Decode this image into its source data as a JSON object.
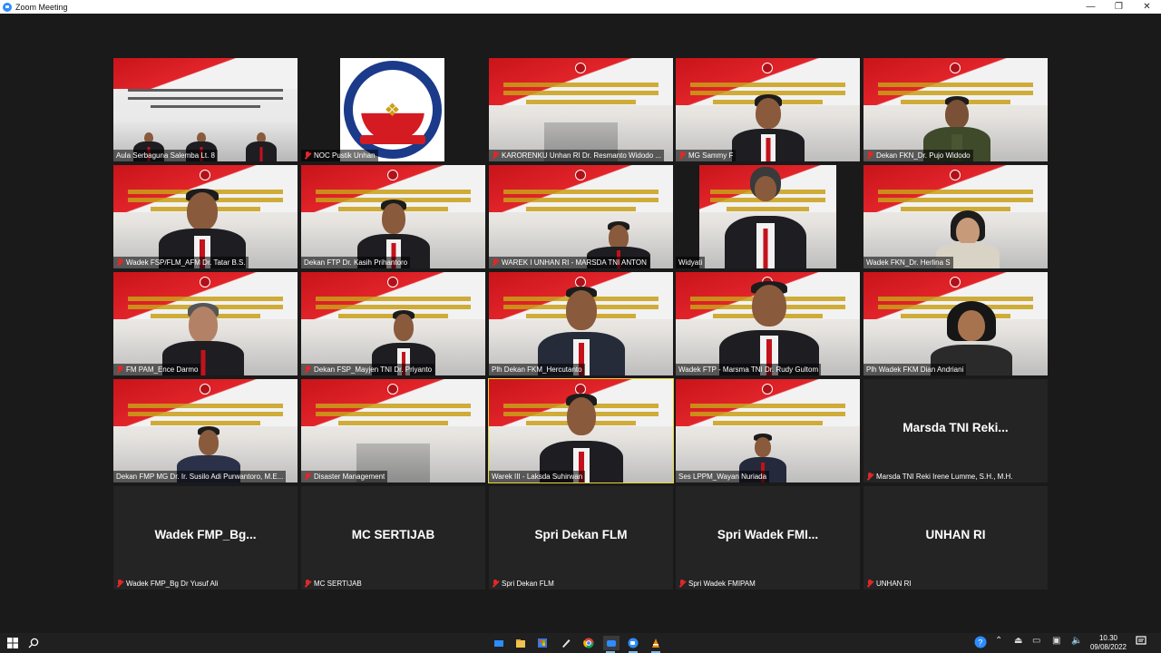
{
  "window": {
    "title": "Zoom Meeting",
    "minimize": "—",
    "restore": "❐",
    "close": "✕"
  },
  "tiles": [
    {
      "name": "Aula Serbaguna Salemba Lt. 8",
      "muted": false
    },
    {
      "name": "NOC Pustik Unhan",
      "muted": true
    },
    {
      "name": "KARORENKU Unhan RI Dr. Resmanto Widodo ...",
      "muted": true
    },
    {
      "name": "MG Sammy F",
      "muted": true
    },
    {
      "name": "Dekan FKN_Dr. Pujo Widodo",
      "muted": true
    },
    {
      "name": "Wadek FSP/FLM_AFM Dr. Tatar B.S.",
      "muted": true
    },
    {
      "name": "Dekan FTP Dr. Kasih Prihantoro",
      "muted": false
    },
    {
      "name": "WAREK I UNHAN RI - MARSDA TNI ANTON",
      "muted": true
    },
    {
      "name": "Widyati",
      "muted": false
    },
    {
      "name": "Wadek FKN_Dr. Herlina S",
      "muted": false
    },
    {
      "name": "FM PAM_Ence Darmo",
      "muted": true
    },
    {
      "name": "Dekan FSP_Mayjen TNI Dr. Priyanto",
      "muted": true
    },
    {
      "name": "Plh Dekan FKM_Hercutanto",
      "muted": false
    },
    {
      "name": "Wadek FTP - Marsma TNI Dr. Rudy Gultom",
      "muted": false
    },
    {
      "name": "Plh Wadek FKM Dian Andriani",
      "muted": false
    },
    {
      "name": "Dekan FMP MG Dr. Ir. Susilo Adi Purwantoro, M.E...",
      "muted": false
    },
    {
      "name": "Disaster Management",
      "muted": true
    },
    {
      "name": "Warek III - Laksda Suhirwan",
      "muted": false
    },
    {
      "name": "Ses LPPM_Wayan Nuriada",
      "muted": false
    },
    {
      "name": "Marsda TNI Reki Irene Lumme, S.H., M.H.",
      "muted": true,
      "display": "Marsda  TNI  Reki..."
    },
    {
      "name": "Wadek FMP_Bg Dr Yusuf Ali",
      "muted": true,
      "display": "Wadek  FMP_Bg..."
    },
    {
      "name": "MC SERTIJAB",
      "muted": true,
      "display": "MC SERTIJAB"
    },
    {
      "name": "Spri Dekan FLM",
      "muted": true,
      "display": "Spri Dekan FLM"
    },
    {
      "name": "Spri Wadek FMIPAM",
      "muted": true,
      "display": "Spri  Wadek  FMI..."
    },
    {
      "name": "UNHAN RI",
      "muted": true,
      "display": "UNHAN RI"
    }
  ],
  "slide": {
    "line1": "PENYUMPAHAN, PELANTIKAN DAN SERTIJAB",
    "line2": "PEJABAT ESELON I DAN ESELON II",
    "line3": "UNIVERSITAS PERTAHANAN RI"
  },
  "logo": {
    "top_text": "UNIVERSITAS PERTAHANAN",
    "bottom_text": "REPUBLIK INDONESIA"
  },
  "taskbar": {
    "time": "10.30",
    "date": "09/08/2022"
  },
  "colors": {
    "active_speaker": "#e6d93a",
    "muted_icon": "#e02828",
    "background": "#1a1a1a"
  }
}
